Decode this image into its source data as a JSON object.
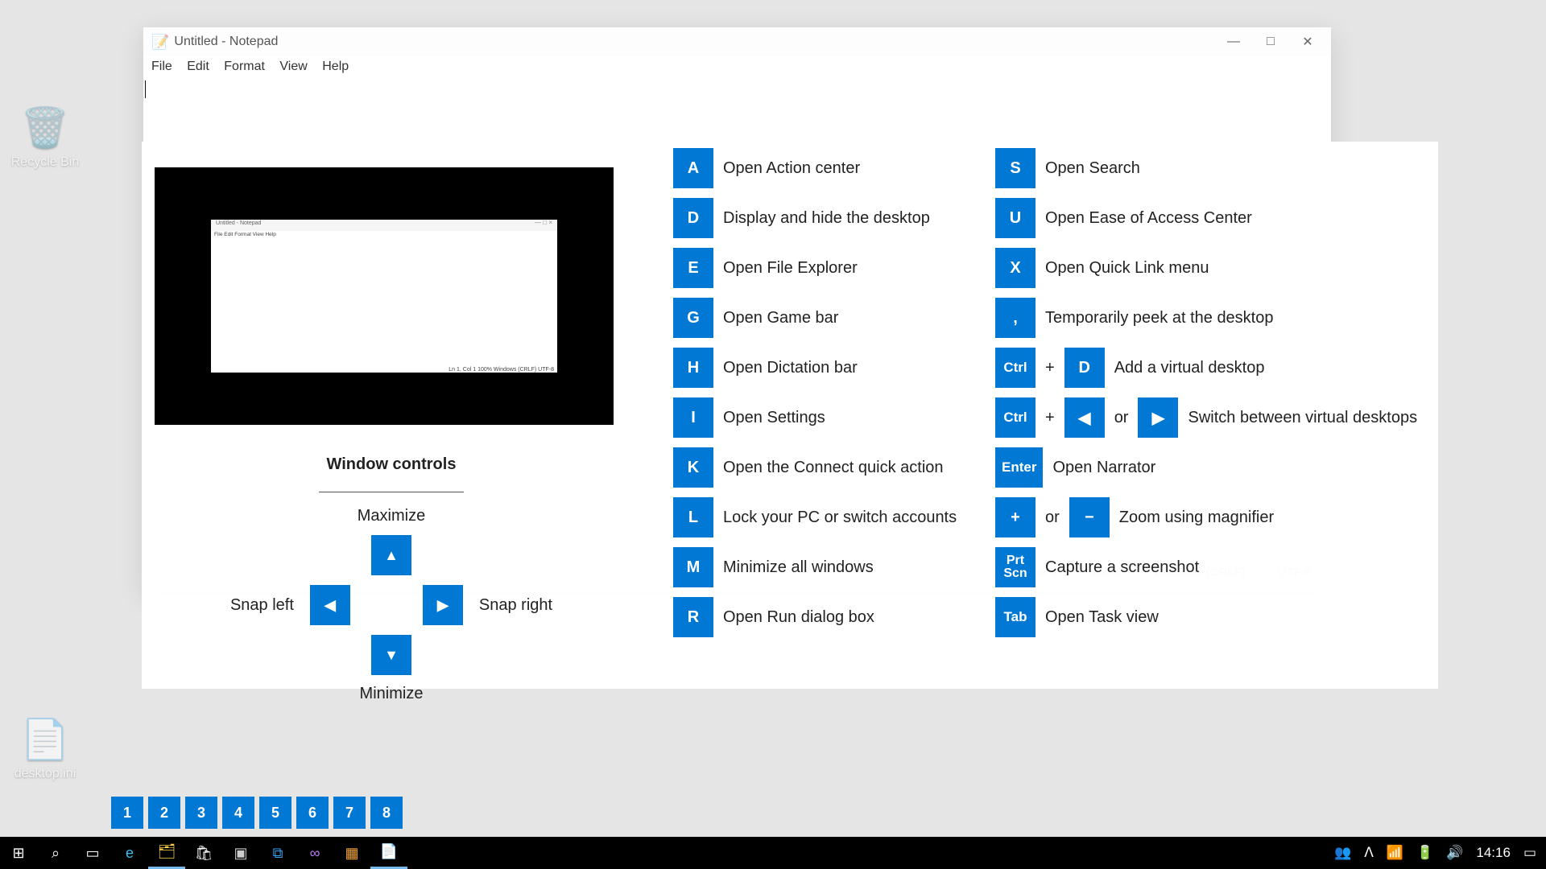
{
  "desktop_icons": {
    "recycle": "Recycle Bin",
    "ini": "desktop.ini"
  },
  "notepad": {
    "title": "Untitled - Notepad",
    "menu": {
      "file": "File",
      "edit": "Edit",
      "format": "Format",
      "view": "View",
      "help": "Help"
    },
    "status": {
      "pos": "Ln 1, Col 1",
      "zoom": "100%",
      "eol": "Windows (CRLF)",
      "enc": "UTF-8"
    }
  },
  "overlay": {
    "preview_menu": "File  Edit  Format  View  Help",
    "preview_status": "Ln 1, Col 1    100%    Windows (CRLF)    UTF-8",
    "window_controls_title": "Window controls",
    "maximize": "Maximize",
    "minimize": "Minimize",
    "snap_left": "Snap left",
    "snap_right": "Snap right",
    "arrow_up": "▲",
    "arrow_down": "▼",
    "arrow_left": "◀",
    "arrow_right": "▶",
    "col1": [
      {
        "key": "A",
        "desc": "Open Action center"
      },
      {
        "key": "D",
        "desc": "Display and hide the desktop"
      },
      {
        "key": "E",
        "desc": "Open File Explorer"
      },
      {
        "key": "G",
        "desc": "Open Game bar"
      },
      {
        "key": "H",
        "desc": "Open Dictation bar"
      },
      {
        "key": "I",
        "desc": "Open Settings"
      },
      {
        "key": "K",
        "desc": "Open the Connect quick action"
      },
      {
        "key": "L",
        "desc": "Lock your PC or switch accounts"
      },
      {
        "key": "M",
        "desc": "Minimize all windows"
      },
      {
        "key": "R",
        "desc": "Open Run dialog box"
      }
    ],
    "col2_simple": [
      {
        "key": "S",
        "desc": "Open Search"
      },
      {
        "key": "U",
        "desc": "Open Ease of Access Center"
      },
      {
        "key": "X",
        "desc": "Open Quick Link menu"
      },
      {
        "key": ",",
        "desc": "Temporarily peek at the desktop"
      }
    ],
    "ctrl_d": {
      "ctrl": "Ctrl",
      "plus": "+",
      "key": "D",
      "desc": "Add a virtual desktop"
    },
    "ctrl_arrows": {
      "ctrl": "Ctrl",
      "plus": "+",
      "left": "◀",
      "or": "or",
      "right": "▶",
      "desc": "Switch between virtual desktops"
    },
    "enter": {
      "key": "Enter",
      "desc": "Open Narrator"
    },
    "zoom": {
      "plus_key": "+",
      "or": "or",
      "minus_key": "−",
      "desc": "Zoom using magnifier"
    },
    "prtscn": {
      "key_line1": "Prt",
      "key_line2": "Scn",
      "desc": "Capture a screenshot"
    },
    "tab": {
      "key": "Tab",
      "desc": "Open Task view"
    }
  },
  "taskbar_numbers": [
    "1",
    "2",
    "3",
    "4",
    "5",
    "6",
    "7",
    "8"
  ],
  "taskbar": {
    "clock": "14:16"
  }
}
